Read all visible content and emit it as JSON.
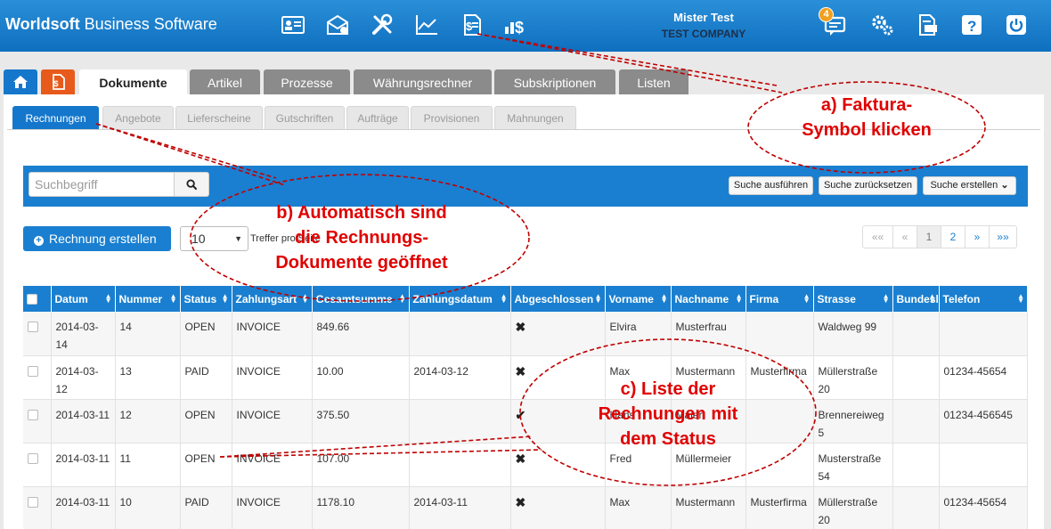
{
  "app": {
    "brand_bold": "Worldsoft",
    "brand_rest": " Business Software"
  },
  "user": {
    "name": "Mister Test",
    "company": "TEST COMPANY"
  },
  "notifications": {
    "count": "4"
  },
  "main_tabs": [
    "Dokumente",
    "Artikel",
    "Prozesse",
    "Währungsrechner",
    "Subskriptionen",
    "Listen"
  ],
  "sub_tabs": [
    "Rechnungen",
    "Angebote",
    "Lieferscheine",
    "Gutschriften",
    "Aufträge",
    "Provisionen",
    "Mahnungen"
  ],
  "search": {
    "placeholder": "Suchbegriff",
    "execute_label": "Suche ausführen",
    "reset_label": "Suche zurücksetzen",
    "create_label": "Suche erstellen"
  },
  "toolbar": {
    "create_invoice_label": "Rechnung erstellen",
    "per_page_value": "10",
    "per_page_label": "Treffer pro Seite"
  },
  "pagination": [
    "««",
    "«",
    "1",
    "2",
    "»",
    "»»"
  ],
  "table": {
    "columns": [
      "Datum",
      "Nummer",
      "Status",
      "Zahlungsart",
      "Gesamtsumme",
      "Zahlungsdatum",
      "Abgeschlossen",
      "Vorname",
      "Nachname",
      "Firma",
      "Strasse",
      "Bundesland",
      "Telefon"
    ],
    "rows": [
      {
        "datum": "2014-03-14",
        "nummer": "14",
        "status": "OPEN",
        "zahlungsart": "INVOICE",
        "gesamtsumme": "849.66",
        "zahlungsdatum": "",
        "abgeschlossen": "✖",
        "vorname": "Elvira",
        "nachname": "Musterfrau",
        "firma": "",
        "strasse": "Waldweg 99",
        "bundesland": "",
        "telefon": ""
      },
      {
        "datum": "2014-03-12",
        "nummer": "13",
        "status": "PAID",
        "zahlungsart": "INVOICE",
        "gesamtsumme": "10.00",
        "zahlungsdatum": "2014-03-12",
        "abgeschlossen": "✖",
        "vorname": "Max",
        "nachname": "Mustermann",
        "firma": "Musterfirma",
        "strasse": "Müllerstraße 20",
        "bundesland": "",
        "telefon": "01234-45654"
      },
      {
        "datum": "2014-03-11",
        "nummer": "12",
        "status": "OPEN",
        "zahlungsart": "INVOICE",
        "gesamtsumme": "375.50",
        "zahlungsdatum": "",
        "abgeschlossen": "✔",
        "vorname": "Hans",
        "nachname": "Maier",
        "firma": "",
        "strasse": "Brennereiweg 5",
        "bundesland": "",
        "telefon": "01234-456545"
      },
      {
        "datum": "2014-03-11",
        "nummer": "11",
        "status": "OPEN",
        "zahlungsart": "INVOICE",
        "gesamtsumme": "107.00",
        "zahlungsdatum": "",
        "abgeschlossen": "✖",
        "vorname": "Fred",
        "nachname": "Müllermeier",
        "firma": "",
        "strasse": "Musterstraße 54",
        "bundesland": "",
        "telefon": ""
      },
      {
        "datum": "2014-03-11",
        "nummer": "10",
        "status": "PAID",
        "zahlungsart": "INVOICE",
        "gesamtsumme": "1178.10",
        "zahlungsdatum": "2014-03-11",
        "abgeschlossen": "✖",
        "vorname": "Max",
        "nachname": "Mustermann",
        "firma": "Musterfirma",
        "strasse": "Müllerstraße 20",
        "bundesland": "",
        "telefon": "01234-45654"
      }
    ]
  },
  "annotations": {
    "a_line1": "a) Faktura-",
    "a_line2": "Symbol klicken",
    "b_line1": "b) Automatisch sind",
    "b_line2": "die Rechnungs-",
    "b_line3": "Dokumente geöffnet",
    "c_line1": "c) Liste der",
    "c_line2": "Rechnungen mit",
    "c_line3": "dem Status"
  },
  "colors": {
    "primary": "#1a7fd0",
    "faktura": "#e85a1b",
    "tab_inactive": "#8b8b8b",
    "annotation": "#e00000"
  }
}
